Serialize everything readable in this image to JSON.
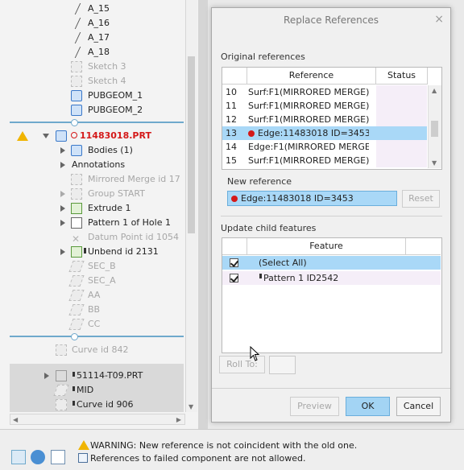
{
  "tree": {
    "items": [
      {
        "label": "A_15"
      },
      {
        "label": "A_16"
      },
      {
        "label": "A_17"
      },
      {
        "label": "A_18"
      },
      {
        "label": "Sketch 3"
      },
      {
        "label": "Sketch 4"
      },
      {
        "label": "PUBGEOM_1"
      },
      {
        "label": "PUBGEOM_2"
      },
      {
        "label": "11483018.PRT"
      },
      {
        "label": "Bodies (1)"
      },
      {
        "label": "Annotations"
      },
      {
        "label": "Mirrored Merge id 17"
      },
      {
        "label": "Group START"
      },
      {
        "label": "Extrude 1"
      },
      {
        "label": "Pattern 1 of Hole 1"
      },
      {
        "label": "Datum Point id 1054"
      },
      {
        "label": "Unbend id 2131"
      },
      {
        "label": "SEC_B"
      },
      {
        "label": "SEC_A"
      },
      {
        "label": "AA"
      },
      {
        "label": "BB"
      },
      {
        "label": "CC"
      },
      {
        "label": "Curve id 842"
      },
      {
        "label": "51114-T09.PRT"
      },
      {
        "label": "MID"
      },
      {
        "label": "Curve id 906"
      }
    ]
  },
  "dialog": {
    "title": "Replace References",
    "close": "×",
    "original_label": "Original references",
    "ref_headers": {
      "reference": "Reference",
      "status": "Status"
    },
    "ref_rows": [
      {
        "num": "10",
        "ref": "Surf:F1(MIRRORED MERGE):1"
      },
      {
        "num": "11",
        "ref": "Surf:F1(MIRRORED MERGE):1"
      },
      {
        "num": "12",
        "ref": "Surf:F1(MIRRORED MERGE):1"
      },
      {
        "num": "13",
        "ref": "Edge:11483018 ID=3453"
      },
      {
        "num": "14",
        "ref": "Edge:F1(MIRRORED MERGE):"
      },
      {
        "num": "15",
        "ref": "Surf:F1(MIRRORED MERGE):1"
      }
    ],
    "new_label": "New reference",
    "new_value": "Edge:11483018 ID=3453",
    "reset": "Reset",
    "update_label": "Update child features",
    "feature_header": "Feature",
    "features": [
      {
        "label": "(Select All)"
      },
      {
        "label": "Pattern 1 ID2542"
      }
    ],
    "roll_to": "Roll To:",
    "preview": "Preview",
    "ok": "OK",
    "cancel": "Cancel"
  },
  "status": {
    "warning": "WARNING: New reference is not coincident with the old one.",
    "info": "References to failed component are not allowed."
  },
  "colors": {
    "selection": "#a9d8f7",
    "accent": "#6fa9cc",
    "error": "#d41919",
    "warning": "#f0b400"
  }
}
